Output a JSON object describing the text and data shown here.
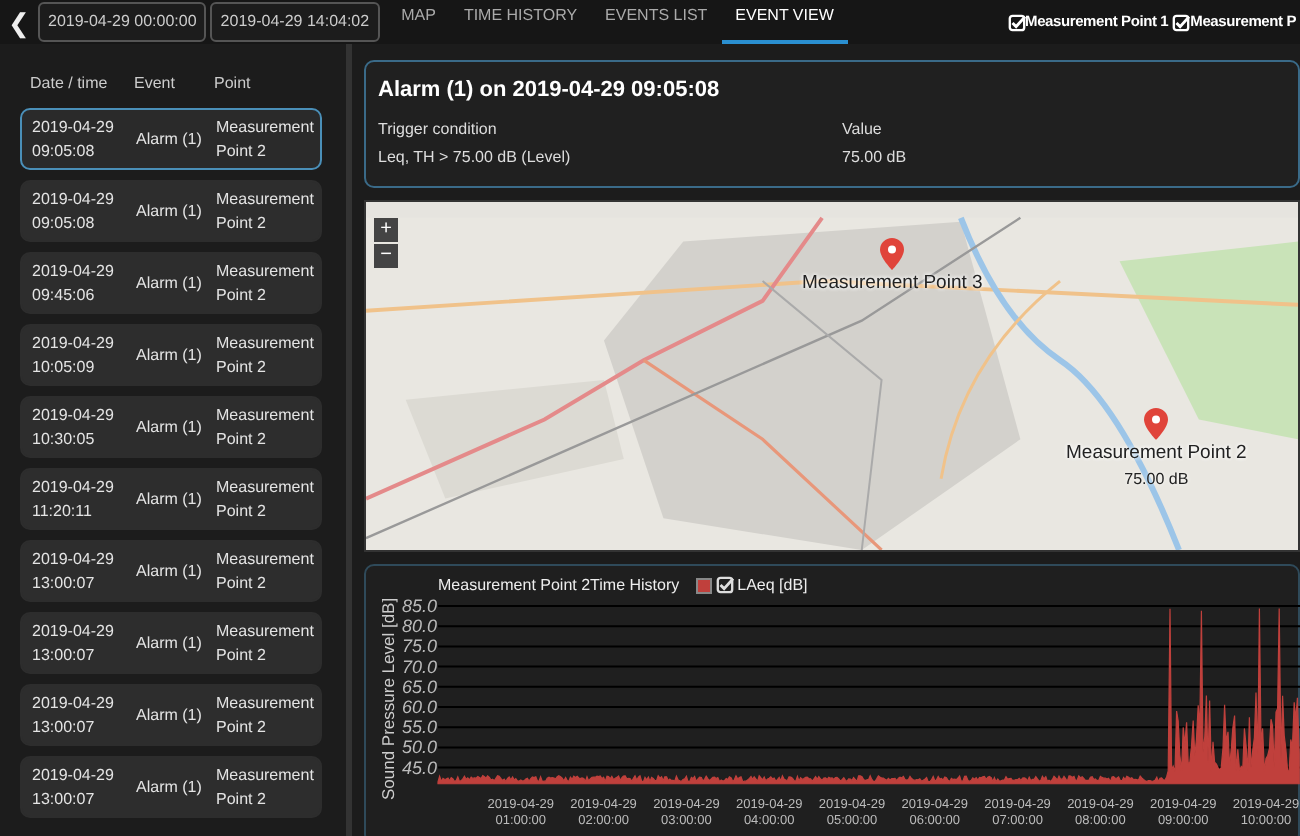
{
  "toolbar": {
    "back_label": "❮",
    "date_from": "2019-04-29 00:00:00",
    "date_to": "2019-04-29 14:04:02"
  },
  "tabs": [
    {
      "label": "MAP",
      "selected": false
    },
    {
      "label": "TIME HISTORY",
      "selected": false
    },
    {
      "label": "EVENTS LIST",
      "selected": false
    },
    {
      "label": "EVENT VIEW",
      "selected": true
    }
  ],
  "point_filters": [
    {
      "label": "Measurement Point 1",
      "checked": true
    },
    {
      "label": "Measurement P",
      "checked": true
    }
  ],
  "events": {
    "columns": [
      "Date / time",
      "Event",
      "Point"
    ],
    "rows": [
      {
        "datetime": "2019-04-29 09:05:08",
        "event": "Alarm (1)",
        "point": "Measurement Point 2",
        "selected": true
      },
      {
        "datetime": "2019-04-29 09:05:08",
        "event": "Alarm (1)",
        "point": "Measurement Point 2",
        "selected": false
      },
      {
        "datetime": "2019-04-29 09:45:06",
        "event": "Alarm (1)",
        "point": "Measurement Point 2",
        "selected": false
      },
      {
        "datetime": "2019-04-29 10:05:09",
        "event": "Alarm (1)",
        "point": "Measurement Point 2",
        "selected": false
      },
      {
        "datetime": "2019-04-29 10:30:05",
        "event": "Alarm (1)",
        "point": "Measurement Point 2",
        "selected": false
      },
      {
        "datetime": "2019-04-29 11:20:11",
        "event": "Alarm (1)",
        "point": "Measurement Point 2",
        "selected": false
      },
      {
        "datetime": "2019-04-29 13:00:07",
        "event": "Alarm (1)",
        "point": "Measurement Point 2",
        "selected": false
      },
      {
        "datetime": "2019-04-29 13:00:07",
        "event": "Alarm (1)",
        "point": "Measurement Point 2",
        "selected": false
      },
      {
        "datetime": "2019-04-29 13:00:07",
        "event": "Alarm (1)",
        "point": "Measurement Point 2",
        "selected": false
      },
      {
        "datetime": "2019-04-29 13:00:07",
        "event": "Alarm (1)",
        "point": "Measurement Point 2",
        "selected": false
      }
    ]
  },
  "alarm": {
    "title": "Alarm (1) on 2019-04-29 09:05:08",
    "fields": [
      {
        "label": "Trigger condition",
        "value": "Leq, TH > 75.00 dB (Level)"
      },
      {
        "label": "Value",
        "value": "75.00 dB"
      }
    ]
  },
  "map": {
    "zoom_in": "+",
    "zoom_out": "−",
    "markers": [
      {
        "label": "Measurement Point 3"
      },
      {
        "label": "Measurement Point 2",
        "reading": "75.00 dB"
      }
    ]
  },
  "chart": {
    "title": "Measurement Point 2Time History",
    "legend": {
      "label": "LAeq [dB]",
      "checked": true,
      "color": "#c0403c"
    },
    "ylabel": "Sound Pressure Level [dB]",
    "yticks": [
      "85.0",
      "80.0",
      "75.0",
      "70.0",
      "65.0",
      "60.0",
      "55.0",
      "50.0",
      "45.0"
    ],
    "xticks": [
      {
        "date": "2019-04-29",
        "time": "01:00:00"
      },
      {
        "date": "2019-04-29",
        "time": "02:00:00"
      },
      {
        "date": "2019-04-29",
        "time": "03:00:00"
      },
      {
        "date": "2019-04-29",
        "time": "04:00:00"
      },
      {
        "date": "2019-04-29",
        "time": "05:00:00"
      },
      {
        "date": "2019-04-29",
        "time": "06:00:00"
      },
      {
        "date": "2019-04-29",
        "time": "07:00:00"
      },
      {
        "date": "2019-04-29",
        "time": "08:00:00"
      },
      {
        "date": "2019-04-29",
        "time": "09:00:00"
      },
      {
        "date": "2019-04-29",
        "time": "10:00:00"
      }
    ]
  }
}
